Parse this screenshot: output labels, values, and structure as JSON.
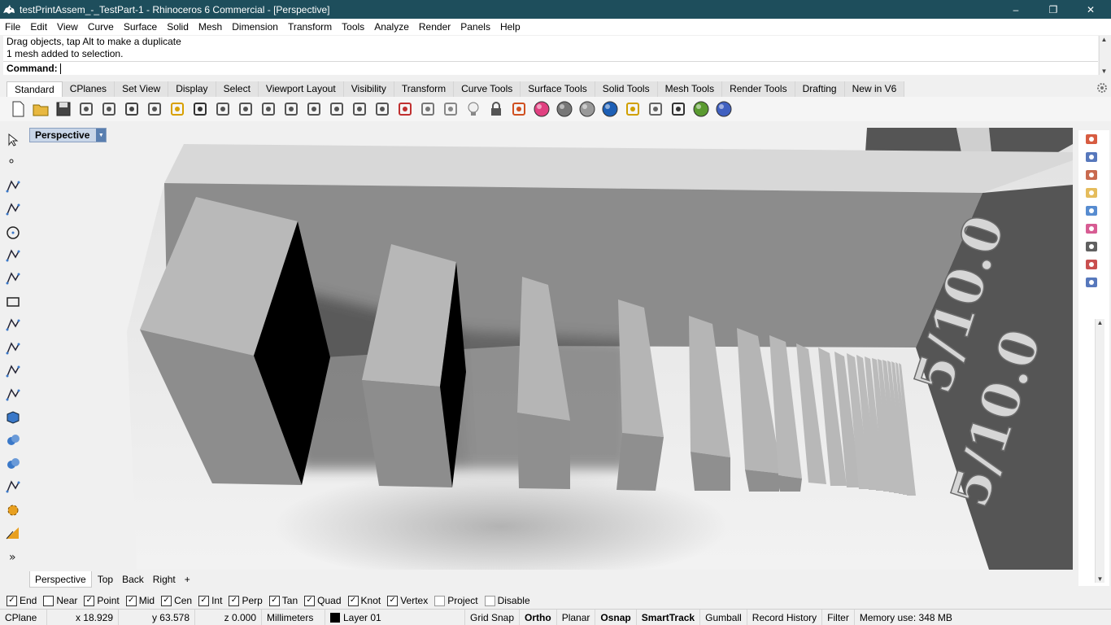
{
  "window": {
    "title": "testPrintAssem_-_TestPart-1 - Rhinoceros 6 Commercial - [Perspective]",
    "minimize": "–",
    "restore": "❐",
    "close": "✕"
  },
  "menu": [
    "File",
    "Edit",
    "View",
    "Curve",
    "Surface",
    "Solid",
    "Mesh",
    "Dimension",
    "Transform",
    "Tools",
    "Analyze",
    "Render",
    "Panels",
    "Help"
  ],
  "command": {
    "history": [
      "Drag objects, tap Alt to make a duplicate",
      "1 mesh added to selection."
    ],
    "prompt": "Command:",
    "value": ""
  },
  "toolbar_tabs": {
    "items": [
      "Standard",
      "CPlanes",
      "Set View",
      "Display",
      "Select",
      "Viewport Layout",
      "Visibility",
      "Transform",
      "Curve Tools",
      "Surface Tools",
      "Solid Tools",
      "Mesh Tools",
      "Render Tools",
      "Drafting",
      "New in V6"
    ],
    "active": "Standard"
  },
  "standard_tools": [
    "new-icon",
    "open-icon",
    "save-icon",
    "print-icon",
    "export-icon",
    "cut-icon",
    "copy-icon",
    "paste-icon",
    "undo-icon",
    "pan-icon",
    "rotate-view-icon",
    "zoom-icon",
    "zoom-window-icon",
    "zoom-extents-icon",
    "zoom-selected-icon",
    "rotate-camera-icon",
    "four-viewports-icon",
    "car-render-icon",
    "properties-icon",
    "show-hide-icon",
    "lightbulb-icon",
    "lock-icon",
    "layer-icon",
    "color-wheel-icon",
    "shaded-sphere-icon",
    "rendered-sphere-icon",
    "blue-sphere-icon",
    "filter-icon",
    "settings-gear-icon",
    "dimension-icon",
    "render-globe-icon",
    "help-icon"
  ],
  "left_tools": [
    "select-arrow-icon",
    "point-icon",
    "polyline-icon",
    "curve-icon",
    "circle-icon",
    "ellipse-icon",
    "arc-icon",
    "rectangle-icon",
    "polygon-icon",
    "fillet-curve-icon",
    "surface-corner-icon",
    "extrude-icon",
    "box-icon",
    "boolean-union-icon",
    "cylinder-icon",
    "mesh-icon",
    "transform-gear-icon",
    "analyze-icon",
    "more-tools-icon"
  ],
  "viewport": {
    "label": "Perspective",
    "dropdown": "▼",
    "text_top": "5/10.0",
    "text_bottom": "5/10.0"
  },
  "viewport_tabs": {
    "items": [
      "Perspective",
      "Top",
      "Back",
      "Right"
    ],
    "active": "Perspective",
    "add": "+"
  },
  "right_panel": [
    "layers-panel-icon",
    "materials-panel-icon",
    "display-panel-icon",
    "files-panel-icon",
    "help-panel-icon",
    "color-panel-icon",
    "named-views-icon",
    "rectangle-panel-icon",
    "sun-panel-icon"
  ],
  "osnaps": [
    {
      "label": "End",
      "checked": true
    },
    {
      "label": "Near",
      "checked": false
    },
    {
      "label": "Point",
      "checked": true
    },
    {
      "label": "Mid",
      "checked": true
    },
    {
      "label": "Cen",
      "checked": true
    },
    {
      "label": "Int",
      "checked": true
    },
    {
      "label": "Perp",
      "checked": true
    },
    {
      "label": "Tan",
      "checked": true
    },
    {
      "label": "Quad",
      "checked": true
    },
    {
      "label": "Knot",
      "checked": true
    },
    {
      "label": "Vertex",
      "checked": true
    },
    {
      "label": "Project",
      "checked": false,
      "disabled": true
    },
    {
      "label": "Disable",
      "checked": false,
      "disabled": true
    }
  ],
  "status": {
    "cplane": "CPlane",
    "x": "x 18.929",
    "y": "y 63.578",
    "z": "z 0.000",
    "units": "Millimeters",
    "layer": "Layer 01",
    "layer_color": "#000000",
    "grid_snap": "Grid Snap",
    "ortho": "Ortho",
    "planar": "Planar",
    "osnap": "Osnap",
    "smarttrack": "SmartTrack",
    "gumball": "Gumball",
    "record_history": "Record History",
    "filter": "Filter",
    "memory": "Memory use: 348 MB"
  }
}
